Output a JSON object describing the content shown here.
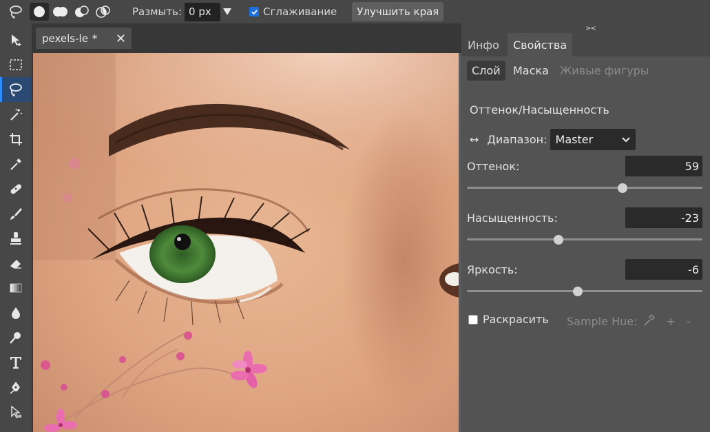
{
  "options_bar": {
    "blur_label": "Размыть:",
    "blur_value": "0 px",
    "smoothing_label": "Сглаживание",
    "smoothing_checked": true,
    "refine_label": "Улучшить края"
  },
  "toolbar": {
    "tools": [
      "move-tool-icon",
      "marquee-tool-icon",
      "lasso-tool-icon",
      "magic-wand-icon",
      "crop-icon",
      "eyedropper-icon",
      "healing-icon",
      "brush-icon",
      "stamp-icon",
      "eraser-icon",
      "gradient-icon",
      "blur-drop-icon",
      "dodge-icon",
      "text-icon",
      "pen-icon",
      "path-select-icon"
    ],
    "active_tool": "lasso-tool-icon"
  },
  "document": {
    "tab_title": "pexels-le",
    "tab_modified": "*",
    "close_glyph": "✕"
  },
  "panel": {
    "collapse_glyph": "><",
    "tabs": [
      "Инфо",
      "Свойства"
    ],
    "active_tab": "Свойства",
    "subtabs": [
      "Слой",
      "Маска",
      "Живые фигуры"
    ],
    "active_subtab": "Слой",
    "section_title": "Оттенок/Насыщенность",
    "range_arrow": "↔",
    "range_label": "Диапазон:",
    "range_value": "Master",
    "fields": [
      {
        "label": "Оттенок:",
        "value": "59",
        "slider_fraction": 0.66
      },
      {
        "label": "Насыщенность:",
        "value": "-23",
        "slider_fraction": 0.39
      },
      {
        "label": "Яркость:",
        "value": "-6",
        "slider_fraction": 0.47
      }
    ],
    "colorize_label": "Раскрасить",
    "colorize_checked": false,
    "sample_hue_label": "Sample Hue:",
    "plus": "+",
    "minus": "-"
  },
  "colors": {
    "accent": "#2e8cff",
    "checkbox_blue": "#1d6fe0",
    "panel_bg": "#535353",
    "chrome_bg": "#474747"
  }
}
